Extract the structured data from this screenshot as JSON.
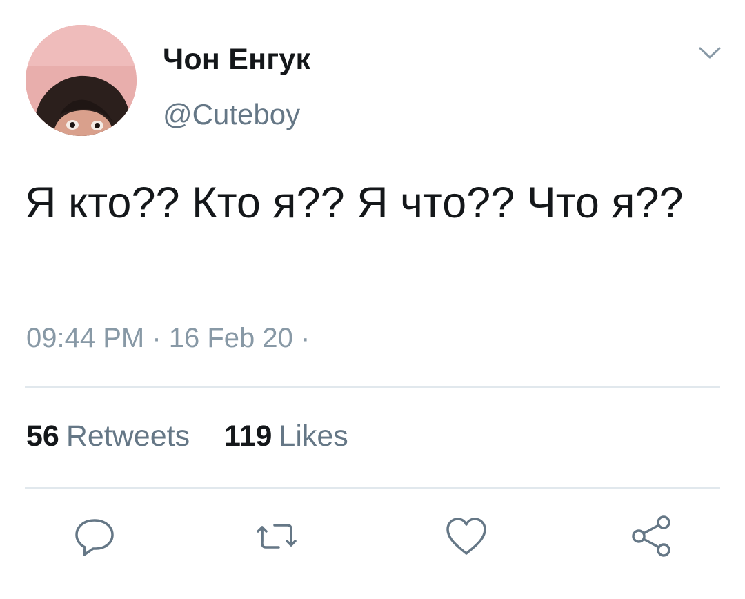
{
  "tweet": {
    "author": {
      "display_name": "Чон Енгук",
      "handle": "@Cuteboy"
    },
    "text": "Я кто?? Кто я?? Я что?? Что я??",
    "timestamp": "09:44 PM · 16 Feb 20 ·",
    "stats": {
      "retweets_count": "56",
      "retweets_label": "Retweets",
      "likes_count": "119",
      "likes_label": "Likes"
    },
    "icons": {
      "menu": "chevron-down-icon",
      "reply": "reply-icon",
      "retweet": "retweet-icon",
      "like": "heart-icon",
      "share": "share-icon"
    },
    "colors": {
      "primary_text": "#14171a",
      "secondary_text": "#657786",
      "timestamp_text": "#8899a6",
      "divider": "#e1e8ed",
      "icon": "#657786"
    }
  }
}
